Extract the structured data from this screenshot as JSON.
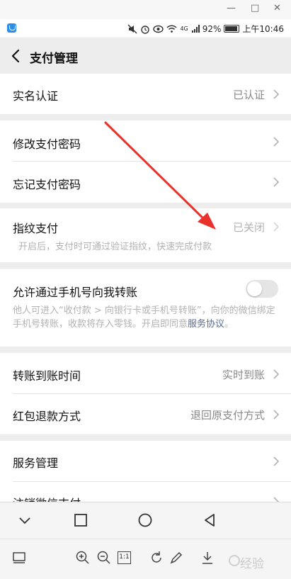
{
  "window": {
    "minimize": "—",
    "maximize": "□",
    "close": "✕"
  },
  "status_bar": {
    "battery": "92%",
    "time": "上午10:46",
    "net": "4G"
  },
  "nav": {
    "title": "支付管理"
  },
  "sections": {
    "realname": {
      "label": "实名认证",
      "value": "已认证"
    },
    "modify_pwd": {
      "label": "修改支付密码"
    },
    "forget_pwd": {
      "label": "忘记支付密码"
    },
    "fingerprint": {
      "label": "指纹支付",
      "value": "已关闭",
      "desc": "开启后，支付时可通过验证指纹，快速完成付款"
    },
    "phone_transfer": {
      "label": "允许通过手机号向我转账",
      "enabled": false,
      "desc": "他人可进入“收付款 > 向银行卡或手机号转账”，向你的微信绑定手机号转账，收款将存入零钱。开启即同意",
      "link": "服务协议",
      "desc_end": "。"
    },
    "arrival_time": {
      "label": "转账到账时间",
      "value": "实时到账"
    },
    "redpacket_refund": {
      "label": "红包退款方式",
      "value": "退回原支付方式"
    },
    "service_mgmt": {
      "label": "服务管理"
    },
    "cancel_pay": {
      "label": "注销微信支付"
    }
  },
  "toolbar": {
    "zoom_reset": "1:1"
  },
  "watermark": {
    "text": "经验"
  },
  "colors": {
    "accent_link": "#576b95",
    "arrow": "#e8322b",
    "bg": "#ededed"
  }
}
